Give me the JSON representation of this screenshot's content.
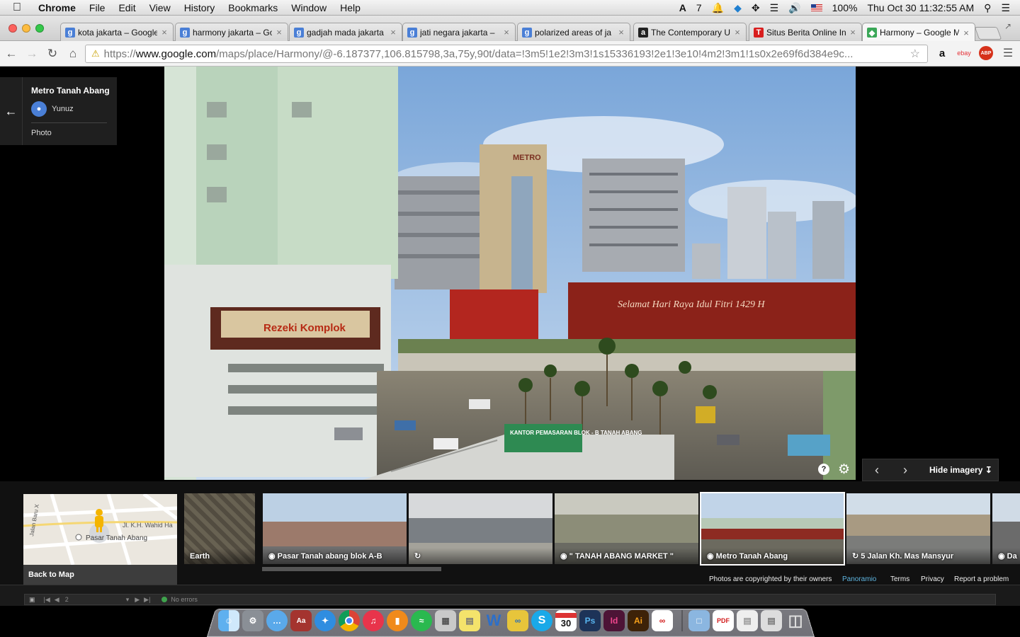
{
  "menubar": {
    "app_name": "Chrome",
    "items": [
      "File",
      "Edit",
      "View",
      "History",
      "Bookmarks",
      "Window",
      "Help"
    ],
    "status": {
      "input_indicator": "7",
      "battery": "100%",
      "clock": "Thu Oct 30  11:32:55 AM"
    }
  },
  "tabs": [
    {
      "title": "kota jakarta – Google",
      "icon": "google-search-icon",
      "icon_text": "g",
      "color": "#4a7fd6",
      "active": false
    },
    {
      "title": "harmony jakarta – Go",
      "icon": "google-search-icon",
      "icon_text": "g",
      "color": "#4a7fd6",
      "active": false
    },
    {
      "title": "gadjah mada jakarta",
      "icon": "google-search-icon",
      "icon_text": "g",
      "color": "#4a7fd6",
      "active": false
    },
    {
      "title": "jati negara jakarta –",
      "icon": "google-search-icon",
      "icon_text": "g",
      "color": "#4a7fd6",
      "active": false
    },
    {
      "title": "polarized areas of ja",
      "icon": "google-search-icon",
      "icon_text": "g",
      "color": "#4a7fd6",
      "active": false
    },
    {
      "title": "The Contemporary U",
      "icon": "atlantic-icon",
      "icon_text": "a",
      "color": "#222222",
      "active": false
    },
    {
      "title": "Situs Berita Online In",
      "icon": "tempo-icon",
      "icon_text": "T",
      "color": "#d81e1e",
      "active": false
    },
    {
      "title": "Harmony – Google M",
      "icon": "google-maps-icon",
      "icon_text": "◆",
      "color": "#3aa757",
      "active": true
    }
  ],
  "toolbar": {
    "url_scheme": "https://",
    "url_host": "www.google.com",
    "url_path": "/maps/place/Harmony/@-6.187377,106.815798,3a,75y,90t/data=!3m5!1e2!3m3!1s15336193!2e1!3e10!4m2!3m1!1s0x2e69f6d384e9c..."
  },
  "extensions": [
    {
      "name": "amazon-icon",
      "text": "a",
      "color": "#222222"
    },
    {
      "name": "ebay-icon",
      "text": "ebay",
      "color": "#e53238"
    },
    {
      "name": "adblock-plus-icon",
      "text": "ABP",
      "color": "#d6311a"
    }
  ],
  "photo_card": {
    "title": "Metro Tanah Abang",
    "author": "Yunuz",
    "type": "Photo"
  },
  "photo_controls": {
    "hide_imagery": "Hide imagery"
  },
  "map_thumb": {
    "street_1": "Jl. K.H. Wahid Ha",
    "street_2": "Jalan Baru X",
    "place": "Pasar Tanah Abang",
    "back_label": "Back to Map"
  },
  "thumbnails": [
    {
      "label": "Earth",
      "kind": "earth"
    },
    {
      "label": "Pasar Tanah abang blok A-B",
      "kind": "photo"
    },
    {
      "label": "",
      "kind": "panorama"
    },
    {
      "label": "\" TANAH ABANG MARKET \"",
      "kind": "photo"
    },
    {
      "label": "Metro Tanah Abang",
      "kind": "photo"
    },
    {
      "label": "5 Jalan Kh. Mas Mansyur",
      "kind": "panorama"
    },
    {
      "label": "Da",
      "kind": "photo"
    }
  ],
  "footer": {
    "copyright": "Photos are copyrighted by their owners",
    "panoramio": "Panoramio",
    "terms": "Terms",
    "privacy": "Privacy",
    "report": "Report a problem"
  },
  "devtools": {
    "page_num": "2",
    "status": "No errors"
  },
  "billboards": {
    "left_sign": "Rezeki Komplok",
    "main_banner": "Selamat Hari Raya Idul Fitri 1429 H",
    "building_sign": "METRO",
    "kantor_sign": "KANTOR PEMASARAN BLOK - B TANAH ABANG"
  },
  "dock": {
    "calendar_day": "30"
  }
}
